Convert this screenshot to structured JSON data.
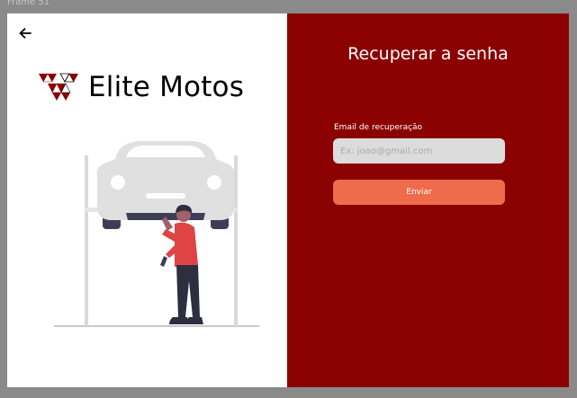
{
  "frame": {
    "label": "Frame 51"
  },
  "colors": {
    "panel_right": "#8b0000",
    "panel_left": "#ffffff",
    "button": "#f06b4b",
    "input_bg": "#dcdcdc",
    "logo_red": "#8b0000"
  },
  "brand": {
    "name": "Elite Motos"
  },
  "nav": {
    "back_icon": "arrow-left-icon"
  },
  "form": {
    "title": "Recuperar a senha",
    "email_label": "Email de recuperação",
    "email_placeholder": "Ex: joao@gmail.com",
    "email_value": "",
    "submit_label": "Enviar"
  }
}
